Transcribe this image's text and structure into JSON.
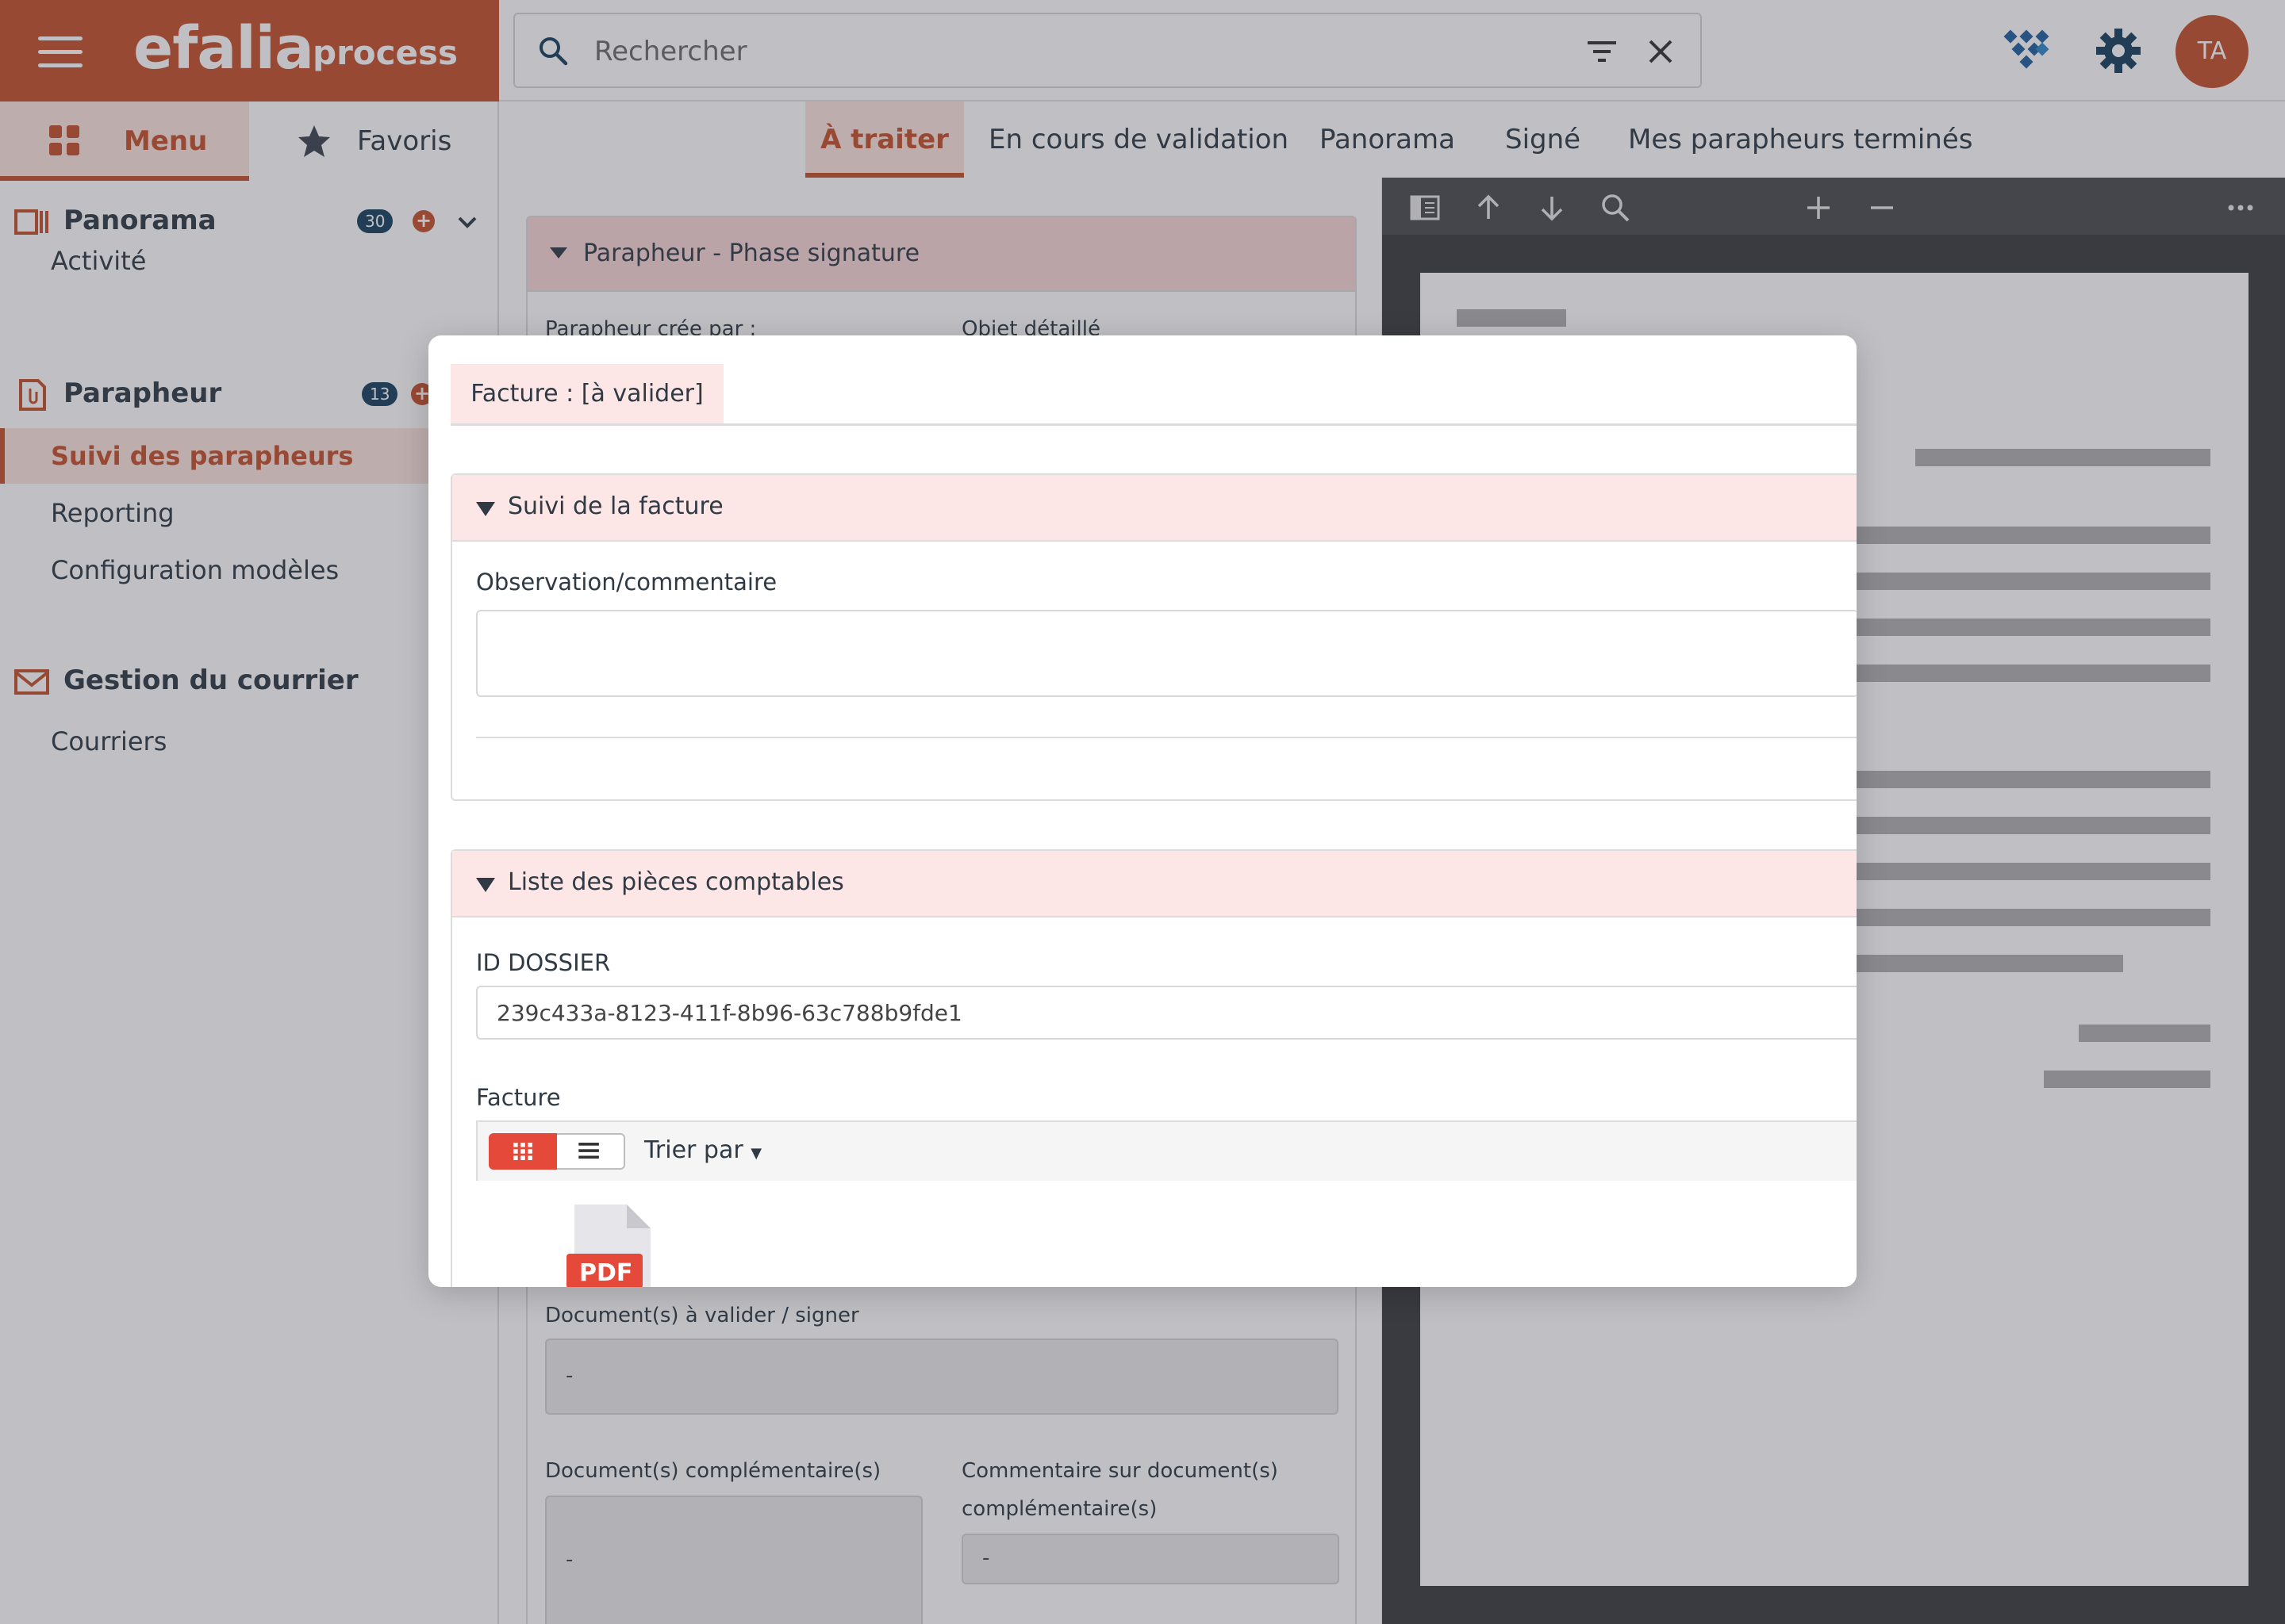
{
  "header": {
    "logo_main": "efalia",
    "logo_sub": "process",
    "search_placeholder": "Rechercher",
    "avatar_initials": "TA"
  },
  "sidebar": {
    "tabs": [
      {
        "label": "Menu",
        "icon": "grid-icon",
        "active": true
      },
      {
        "label": "Favoris",
        "icon": "star-icon",
        "active": false
      }
    ],
    "sections": [
      {
        "title": "Panorama",
        "icon": "panorama-icon",
        "badge": "30",
        "items": [
          "Activité"
        ]
      },
      {
        "title": "Parapheur",
        "icon": "clipboard-icon",
        "badge": "13",
        "items": [
          "Suivi des parapheurs",
          "Reporting",
          "Configuration modèles"
        ],
        "active_item": "Suivi des parapheurs"
      },
      {
        "title": "Gestion du courrier",
        "icon": "mail-icon",
        "items": [
          "Courriers"
        ]
      }
    ]
  },
  "main_tabs": [
    {
      "label": "À traiter",
      "active": true
    },
    {
      "label": "En cours de validation"
    },
    {
      "label": "Panorama"
    },
    {
      "label": "Signé"
    },
    {
      "label": "Mes parapheurs terminés"
    }
  ],
  "background_form": {
    "section_title": "Parapheur - Phase signature",
    "created_by_label": "Parapheur crée par :",
    "object_label": "Objet détaillé",
    "docs_to_validate_label": "Document(s) à valider / signer",
    "docs_to_validate_value": "-",
    "docs_complementary_label": "Document(s) complémentaire(s)",
    "docs_complementary_value": "-",
    "comment_docs_label_1": "Commentaire sur document(s)",
    "comment_docs_label_2": "complémentaire(s)",
    "comment_docs_value": "-"
  },
  "modal": {
    "tab_label": "Facture : [à valider]",
    "section_suivi": {
      "title": "Suivi de la facture",
      "observation_label": "Observation/commentaire",
      "observation_value": ""
    },
    "section_pieces": {
      "title": "Liste des pièces comptables",
      "id_label": "ID DOSSIER",
      "id_value": "239c433a-8123-411f-8b96-63c788b9fde1",
      "facture_label": "Facture",
      "sort_label": "Trier par",
      "file_badge": "PDF"
    }
  },
  "colors": {
    "brand": "#c5502c",
    "badge_dark": "#16405e",
    "accent_red": "#e5493a",
    "section_pink": "#fde6e6"
  }
}
